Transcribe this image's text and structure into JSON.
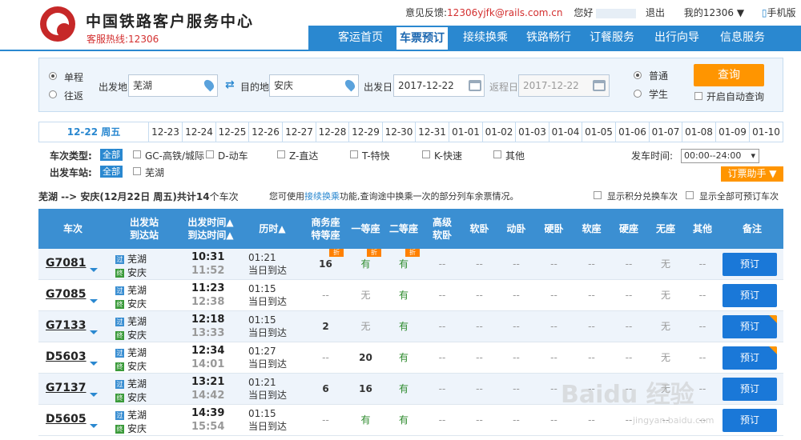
{
  "header": {
    "title": "中国铁路客户服务中心",
    "hotline": "客服热线:12306",
    "feedback_label": "意见反馈:",
    "feedback_email": "12306yjfk@rails.com.cn",
    "greeting": "您好",
    "logout": "退出",
    "my12306": "我的12306 ▼",
    "mobile": "手机版"
  },
  "nav": [
    "客运首页",
    "车票预订",
    "接续换乘",
    "铁路畅行",
    "订餐服务",
    "出行向导",
    "信息服务"
  ],
  "query": {
    "single": "单程",
    "round": "往返",
    "from_label": "出发地",
    "from_value": "芜湖",
    "to_label": "目的地",
    "to_value": "安庆",
    "date_label": "出发日",
    "date_value": "2017-12-22",
    "return_label": "返程日",
    "return_value": "2017-12-22",
    "normal": "普通",
    "student": "学生",
    "query_button": "查询",
    "auto_query": "开启自动查询"
  },
  "dates": [
    "12-22 周五",
    "12-23",
    "12-24",
    "12-25",
    "12-26",
    "12-27",
    "12-28",
    "12-29",
    "12-30",
    "12-31",
    "01-01",
    "01-02",
    "01-03",
    "01-04",
    "01-05",
    "01-06",
    "01-07",
    "01-08",
    "01-09",
    "01-10"
  ],
  "filters": {
    "type_label": "车次类型:",
    "all": "全部",
    "types": [
      "GC-高铁/城际",
      "D-动车",
      "Z-直达",
      "T-特快",
      "K-快速",
      "其他"
    ],
    "depart_time_label": "发车时间:",
    "depart_time_value": "00:00--24:00",
    "station_label": "出发车站:",
    "stations": [
      "芜湖"
    ],
    "helper": "订票助手 ▼"
  },
  "summary": {
    "route": "芜湖 --> 安庆(12月22日 周五)共计",
    "count": "14",
    "unit": "个车次",
    "hint_pre": "您可使用",
    "hint_link": "接续换乘",
    "hint_post": "功能,查询途中换乘一次的部分列车余票情况。",
    "points_label": "显示积分兑换车次",
    "all_label": "显示全部可预订车次"
  },
  "columns": [
    "车次",
    "出发站\n到达站",
    "出发时间▲\n到达时间▲",
    "历时▲",
    "商务座\n特等座",
    "一等座",
    "二等座",
    "高级\n软卧",
    "软卧",
    "动卧",
    "硬卧",
    "软座",
    "硬座",
    "无座",
    "其他",
    "备注"
  ],
  "discount_label": "折",
  "icons": {
    "start": "始",
    "pass": "过",
    "end": "终"
  },
  "rows": [
    {
      "train": "G7081",
      "from": "芜湖",
      "to": "安庆",
      "dep": "10:31",
      "arr": "11:52",
      "dur": "01:21",
      "arrive": "当日到达",
      "seats": [
        "16",
        "有",
        "有",
        "--",
        "--",
        "--",
        "--",
        "--",
        "--",
        "无",
        "--"
      ],
      "book": "预订",
      "badge": false
    },
    {
      "train": "G7085",
      "from": "芜湖",
      "to": "安庆",
      "dep": "11:23",
      "arr": "12:38",
      "dur": "01:15",
      "arrive": "当日到达",
      "seats": [
        "--",
        "无",
        "有",
        "--",
        "--",
        "--",
        "--",
        "--",
        "--",
        "无",
        "--"
      ],
      "book": "预订",
      "badge": false
    },
    {
      "train": "G7133",
      "from": "芜湖",
      "to": "安庆",
      "dep": "12:18",
      "arr": "13:33",
      "dur": "01:15",
      "arrive": "当日到达",
      "seats": [
        "2",
        "无",
        "有",
        "--",
        "--",
        "--",
        "--",
        "--",
        "--",
        "无",
        "--"
      ],
      "book": "预订",
      "badge": true
    },
    {
      "train": "D5603",
      "from": "芜湖",
      "to": "安庆",
      "dep": "12:34",
      "arr": "14:01",
      "dur": "01:27",
      "arrive": "当日到达",
      "seats": [
        "--",
        "20",
        "有",
        "--",
        "--",
        "--",
        "--",
        "--",
        "--",
        "无",
        "--"
      ],
      "book": "预订",
      "badge": true
    },
    {
      "train": "G7137",
      "from": "芜湖",
      "to": "安庆",
      "dep": "13:21",
      "arr": "14:42",
      "dur": "01:21",
      "arrive": "当日到达",
      "seats": [
        "6",
        "16",
        "有",
        "--",
        "--",
        "--",
        "--",
        "--",
        "--",
        "无",
        "--"
      ],
      "book": "预订",
      "badge": false
    },
    {
      "train": "D5605",
      "from": "芜湖",
      "to": "安庆",
      "dep": "14:39",
      "arr": "15:54",
      "dur": "01:15",
      "arrive": "当日到达",
      "seats": [
        "--",
        "有",
        "有",
        "--",
        "--",
        "--",
        "--",
        "--",
        "--",
        "--",
        "--"
      ],
      "book": "预订",
      "badge": false
    }
  ],
  "watermark": {
    "main": "Baidu 经验",
    "sub": "jingyan.baidu.com"
  },
  "colors": {
    "brand_blue": "#2a88d0",
    "accent_orange": "#ff9500",
    "logo_red": "#c62828",
    "available_green": "#2e8b2e"
  }
}
